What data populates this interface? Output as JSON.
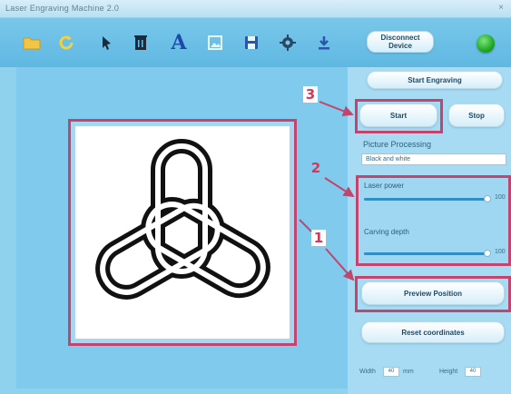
{
  "window": {
    "title": "Laser Engraving Machine 2.0"
  },
  "toolbar": {
    "icons": [
      {
        "name": "open-folder-icon"
      },
      {
        "name": "refresh-icon"
      },
      {
        "name": "mouse-icon"
      },
      {
        "name": "delete-icon"
      },
      {
        "name": "text-icon",
        "glyph": "A"
      },
      {
        "name": "image-icon"
      },
      {
        "name": "save-icon"
      },
      {
        "name": "settings-icon"
      },
      {
        "name": "download-icon"
      }
    ],
    "connect_label": "Disconnect\nDevice"
  },
  "right_panel": {
    "top_button": "Start Engraving",
    "tab_left": "Start",
    "tab_right": "Stop",
    "section_title": "Picture Processing",
    "mode_select": "Black and white",
    "slider_1": {
      "label": "Laser power",
      "value": "100"
    },
    "slider_2": {
      "label": "Carving depth",
      "value": "100"
    },
    "preview_button": "Preview Position",
    "reset_button": "Reset coordinates",
    "bottom": {
      "width_label": "Width",
      "width_value": "40",
      "unit": "mm",
      "height_label": "Height",
      "height_value": "40"
    }
  },
  "callouts": {
    "one": "1",
    "two": "2",
    "three": "3"
  },
  "colors": {
    "highlight": "#c2456d",
    "accent": "#2f8fc4",
    "status": "#1faa25"
  }
}
